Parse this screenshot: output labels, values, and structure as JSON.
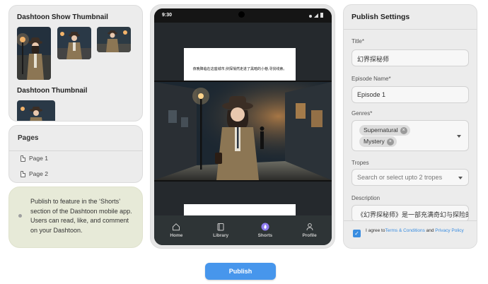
{
  "thumbnails": {
    "show_title": "Dashtoon Show Thumbnail",
    "dashtoon_title": "Dashtoon Thumbnail"
  },
  "pages": {
    "title": "Pages",
    "items": [
      "Page 1",
      "Page 2"
    ]
  },
  "info": {
    "text": "Publish to feature in the ‘Shorts’ section of the Dashtoon mobile app. Users can read, like, and comment on your Dashtoon."
  },
  "phone": {
    "time": "9:30",
    "bubble_text": "夜晚降临在这座城市,侦探悄然走进了黑暗的小巷,寻找线索。",
    "nav": [
      "Home",
      "Library",
      "Shorts",
      "Profile"
    ],
    "active_nav": "Shorts"
  },
  "settings": {
    "title": "Publish Settings",
    "title_label": "Title*",
    "title_value": "幻界探秘师",
    "episode_label": "Episode Name*",
    "episode_value": "Episode 1",
    "genres_label": "Genres*",
    "genres": [
      "Supernatural",
      "Mystery"
    ],
    "tropes_label": "Tropes",
    "tropes_placeholder": "Search or select upto 2 tropes",
    "description_label": "Description",
    "description_value": "《幻界探秘师》是一部充满奇幻与探险的",
    "agree_prefix": "I agree to",
    "terms_link": "Terms & Conditions",
    "agree_and": " and ",
    "privacy_link": "Privacy Policy",
    "agree_checked": true
  },
  "publish_button": "Publish",
  "colors": {
    "accent": "#4796ec",
    "active_nav": "#8f7cf0"
  }
}
